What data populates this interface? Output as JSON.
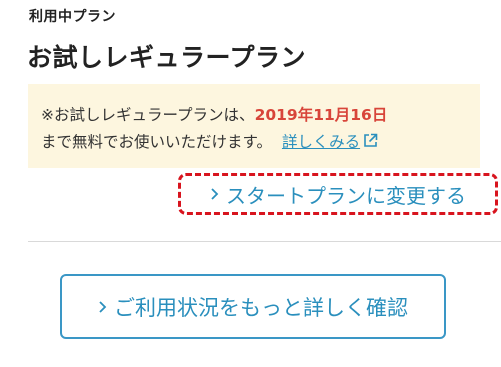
{
  "plan": {
    "section_label": "利用中プラン",
    "name": "お試しレギュラープラン"
  },
  "notice": {
    "text_before_date": "※お試しレギュラープランは、",
    "date": "2019年11月16日",
    "text_after_date": "まで無料でお使いいただけます。",
    "details_link": "詳しくみる",
    "details_link_icon": "external-link-icon",
    "background_color": "#fdf6df",
    "date_color": "#d8453a"
  },
  "actions": {
    "change_plan": "スタートプランに変更する",
    "change_plan_icon": "chevron-right-icon",
    "usage_details": "ご利用状況をもっと詳しく確認",
    "usage_details_icon": "chevron-right-icon",
    "link_color": "#2a8fbd",
    "highlight_border_color": "#d8141e"
  }
}
